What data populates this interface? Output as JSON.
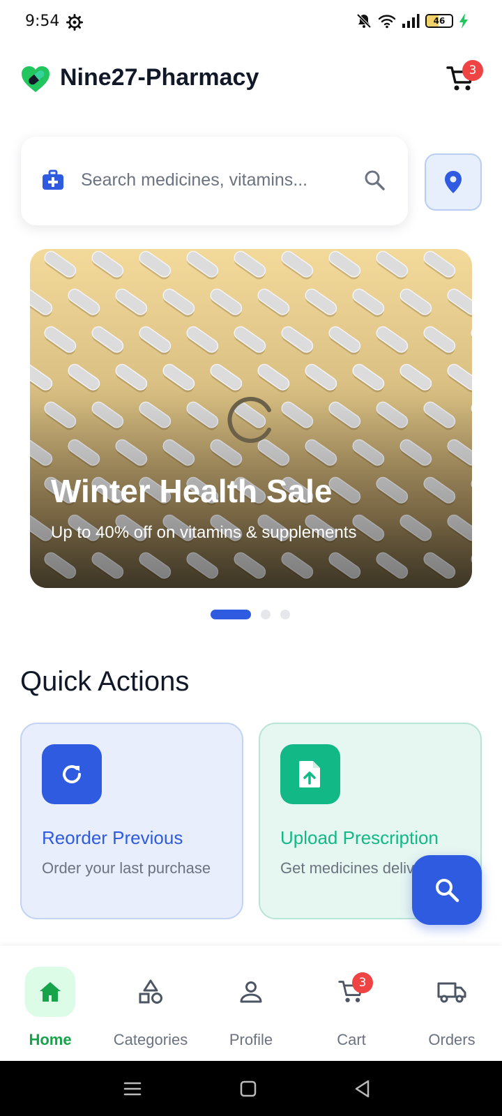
{
  "status_bar": {
    "time": "9:54",
    "battery": "46",
    "battery_level": 0.46
  },
  "header": {
    "app_name": "Nine27-Pharmacy",
    "cart_count": "3"
  },
  "search": {
    "placeholder": "Search medicines, vitamins..."
  },
  "banner": {
    "title": "Winter Health Sale",
    "subtitle": "Up to 40% off on vitamins & supplements",
    "slide_count": 3,
    "active_slide": 1
  },
  "quick_actions": {
    "heading": "Quick Actions",
    "items": [
      {
        "title": "Reorder Previous",
        "description": "Order your last purchase",
        "color": "#2f5be0"
      },
      {
        "title": "Upload Prescription",
        "description": "Get medicines delivered",
        "color": "#12b886"
      }
    ]
  },
  "bottom_nav": {
    "items": [
      {
        "label": "Home",
        "active": true
      },
      {
        "label": "Categories",
        "active": false
      },
      {
        "label": "Profile",
        "active": false
      },
      {
        "label": "Cart",
        "active": false
      },
      {
        "label": "Orders",
        "active": false
      }
    ],
    "cart_badge": "3"
  },
  "colors": {
    "primary": "#2f5be0",
    "success": "#12b886",
    "nav_active": "#16a34a",
    "badge": "#ef4444"
  }
}
